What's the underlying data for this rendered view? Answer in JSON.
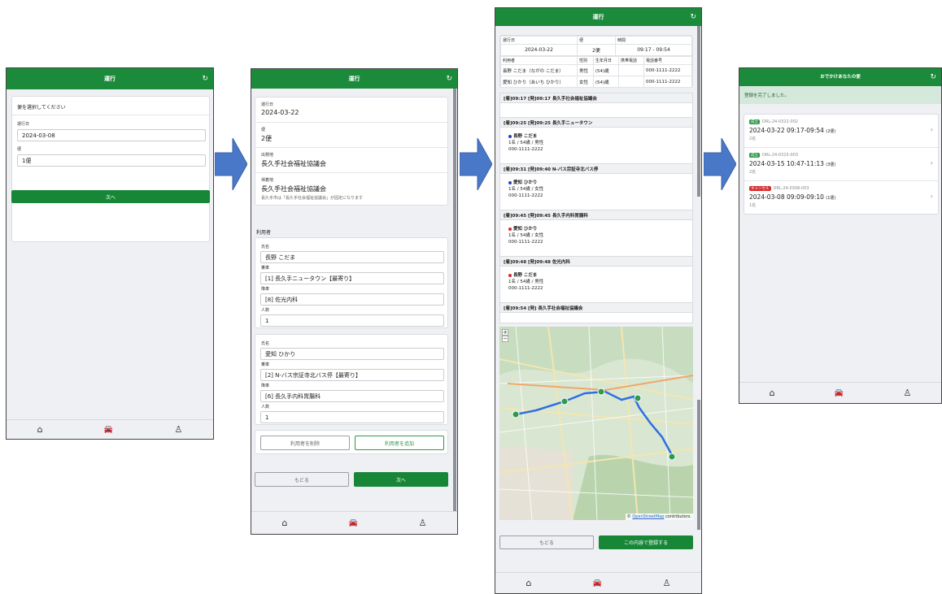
{
  "screen1": {
    "header_title": "運行",
    "prompt": "便を選択してください",
    "date_label": "運行日",
    "date_value": "2024-03-08",
    "bin_label": "便",
    "bin_value": "1便",
    "next_button": "次へ"
  },
  "screen2": {
    "header_title": "運行",
    "date_label": "運行日",
    "date_value": "2024-03-22",
    "bin_label": "便",
    "bin_value": "2便",
    "depart_label": "出発地",
    "depart_value": "長久手社会福祉協議会",
    "return_label": "帰着地",
    "return_value": "長久手社会福祉協議会",
    "return_note": "長久手市は「長久手社会福祉協議会」が固定になります",
    "users_section": "利用者",
    "users": [
      {
        "name_label": "氏名",
        "name": "長野 こだま",
        "board_label": "乗車",
        "board": "[1] 長久手ニュータウン【最寄り】",
        "alight_label": "降車",
        "alight": "[8] 佐光内科",
        "count_label": "人数",
        "count": "1"
      },
      {
        "name_label": "氏名",
        "name": "愛知 ひかり",
        "board_label": "乗車",
        "board": "[2] N-バス宗証寺北バス停【最寄り】",
        "alight_label": "降車",
        "alight": "[6] 長久手内科胃腸科",
        "count_label": "人数",
        "count": "1"
      }
    ],
    "delete_user_button": "利用者を削除",
    "add_user_button": "利用者を追加",
    "back_button": "もどる",
    "next_button": "次へ"
  },
  "screen3": {
    "header_title": "運行",
    "summary_headers": [
      "運行日",
      "便",
      "時間"
    ],
    "summary_values": [
      "2024-03-22",
      "2便",
      "09:17 - 09:54"
    ],
    "user_headers": [
      "利用者",
      "性別",
      "生年月日",
      "携帯電話",
      "電話番号"
    ],
    "user_rows": [
      [
        "長野 こだま（ながの こだま）",
        "男性",
        "(54)歳",
        "",
        "000-1111-2222"
      ],
      [
        "愛知 ひかり（あいち ひかり）",
        "女性",
        "(54)歳",
        "",
        "000-1111-2222"
      ]
    ],
    "stops": [
      {
        "title": "[着]09:17 [発]09:17 長久手社会福祉協議会",
        "persons": []
      },
      {
        "title": "[着]09:25 [発]09:25 長久手ニュータウン",
        "persons": [
          {
            "name": "長野 こだま",
            "info": "1名 / 54歳 / 男性",
            "phone": "000-1111-2222",
            "color": "#2a3fd0"
          }
        ]
      },
      {
        "title": "[着]09:31 [発]09:40 N-バス宗証寺北バス停",
        "persons": [
          {
            "name": "愛知 ひかり",
            "info": "1名 / 54歳 / 女性",
            "phone": "000-1111-2222",
            "color": "#2a3fd0"
          }
        ]
      },
      {
        "title": "[着]09:45 [発]09:45 長久手内科胃腸科",
        "persons": [
          {
            "name": "愛知 ひかり",
            "info": "1名 / 54歳 / 女性",
            "phone": "000-1111-2222",
            "color": "#d82a2a"
          }
        ]
      },
      {
        "title": "[着]09:48 [発]09:48 佐光内科",
        "persons": [
          {
            "name": "長野 こだま",
            "info": "1名 / 54歳 / 男性",
            "phone": "000-1111-2222",
            "color": "#d82a2a"
          }
        ]
      },
      {
        "title": "[着]09:54 [発] 長久手社会福祉協議会",
        "persons": []
      }
    ],
    "map_attribution_prefix": "©",
    "map_attribution_link": "OpenStreetMap",
    "map_attribution_suffix": "contributors.",
    "back_button": "もどる",
    "register_button": "この内容で登録する"
  },
  "screen4": {
    "header_title": "おでかけあなたの便",
    "complete_message": "登録を完了しました。",
    "bookings": [
      {
        "badge": "成立",
        "badge_color": "#2a9a4a",
        "code": "DRL-24-0322-002",
        "datetime": "2024-03-22 09:17-09:54",
        "bin": "(2便)",
        "persons": "2名"
      },
      {
        "badge": "成立",
        "badge_color": "#2a9a4a",
        "code": "DRL-24-0315-003",
        "datetime": "2024-03-15 10:47-11:13",
        "bin": "(3便)",
        "persons": "2名"
      },
      {
        "badge": "キャンセル",
        "badge_color": "#d62c2c",
        "code": "DRL-24-0308-003",
        "datetime": "2024-03-08 09:09-09:10",
        "bin": "(1便)",
        "persons": "1名"
      }
    ]
  },
  "icons": {
    "refresh": "↻",
    "home": "⌂",
    "car": "🚘",
    "user": "♙",
    "chevron": "›"
  },
  "colors": {
    "header_green": "#1b8a3a",
    "button_green": "#178737",
    "arrow_blue": "#4a78c8"
  }
}
